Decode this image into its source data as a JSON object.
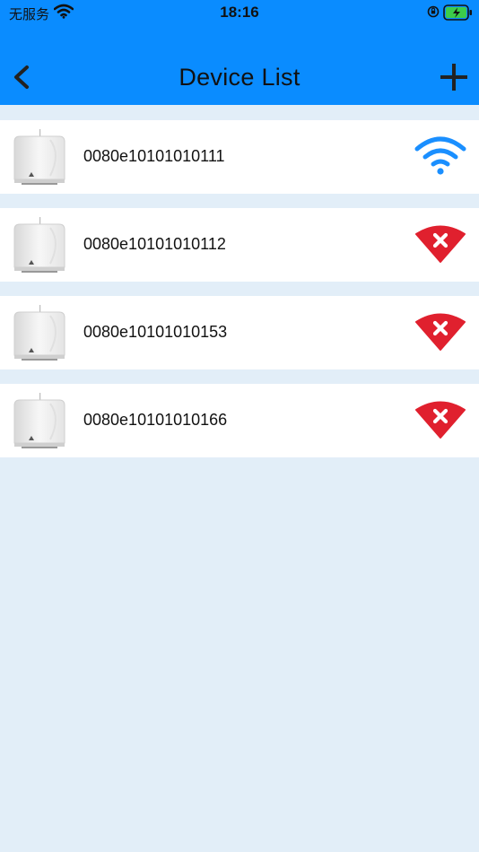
{
  "status_bar": {
    "carrier": "无服务",
    "time": "18:16"
  },
  "nav": {
    "title": "Device List",
    "back_icon": "chevron-left-icon",
    "add_icon": "plus-icon"
  },
  "colors": {
    "header": "#0a8cff",
    "background": "#e2eef8",
    "online": "#1a8fff",
    "offline": "#e0202e"
  },
  "devices": [
    {
      "id": "0080e10101010111",
      "status": "online",
      "icon": "wifi-icon"
    },
    {
      "id": "0080e10101010112",
      "status": "offline",
      "icon": "wifi-off-icon"
    },
    {
      "id": "0080e10101010153",
      "status": "offline",
      "icon": "wifi-off-icon"
    },
    {
      "id": "0080e10101010166",
      "status": "offline",
      "icon": "wifi-off-icon"
    }
  ]
}
